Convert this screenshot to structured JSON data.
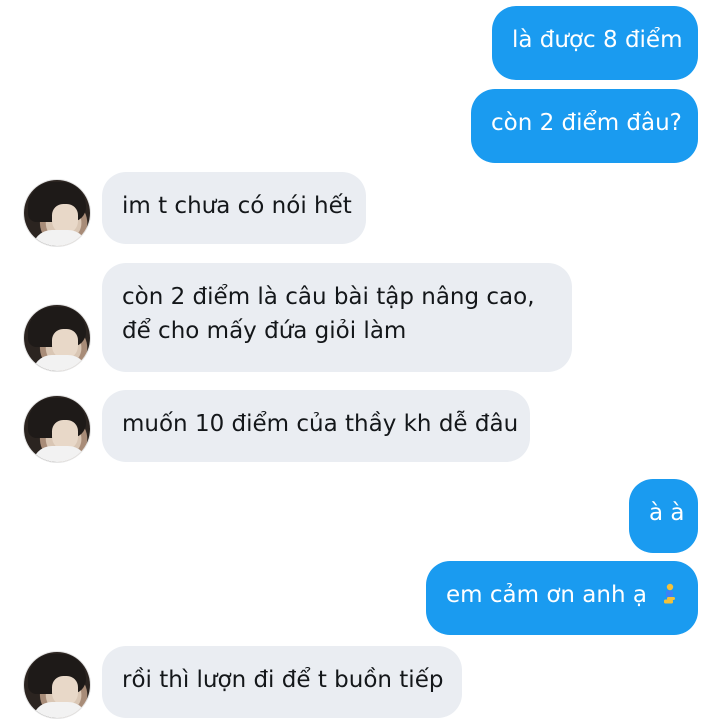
{
  "messages": [
    {
      "from": "me",
      "text": "là được 8 điểm"
    },
    {
      "from": "me",
      "text": "còn 2 điểm đâu?"
    },
    {
      "from": "them",
      "text": "im t chưa có nói hết"
    },
    {
      "from": "them",
      "line1": "còn 2 điểm là câu bài tập nâng cao,",
      "line2": "để cho mấy đứa giỏi làm"
    },
    {
      "from": "them",
      "text": "muốn 10 điểm của thầy kh dễ đâu"
    },
    {
      "from": "me",
      "text": "à à"
    },
    {
      "from": "me",
      "text": "em cảm ơn anh ạ",
      "emoji": "person-kneeling-emoji"
    },
    {
      "from": "them",
      "text": "rồi thì lượn đi để t buồn tiếp"
    }
  ],
  "colors": {
    "outgoing_bubble": "#1a9bf0",
    "incoming_bubble": "#eaedf2",
    "outgoing_text": "#ffffff",
    "incoming_text": "#14171a"
  }
}
